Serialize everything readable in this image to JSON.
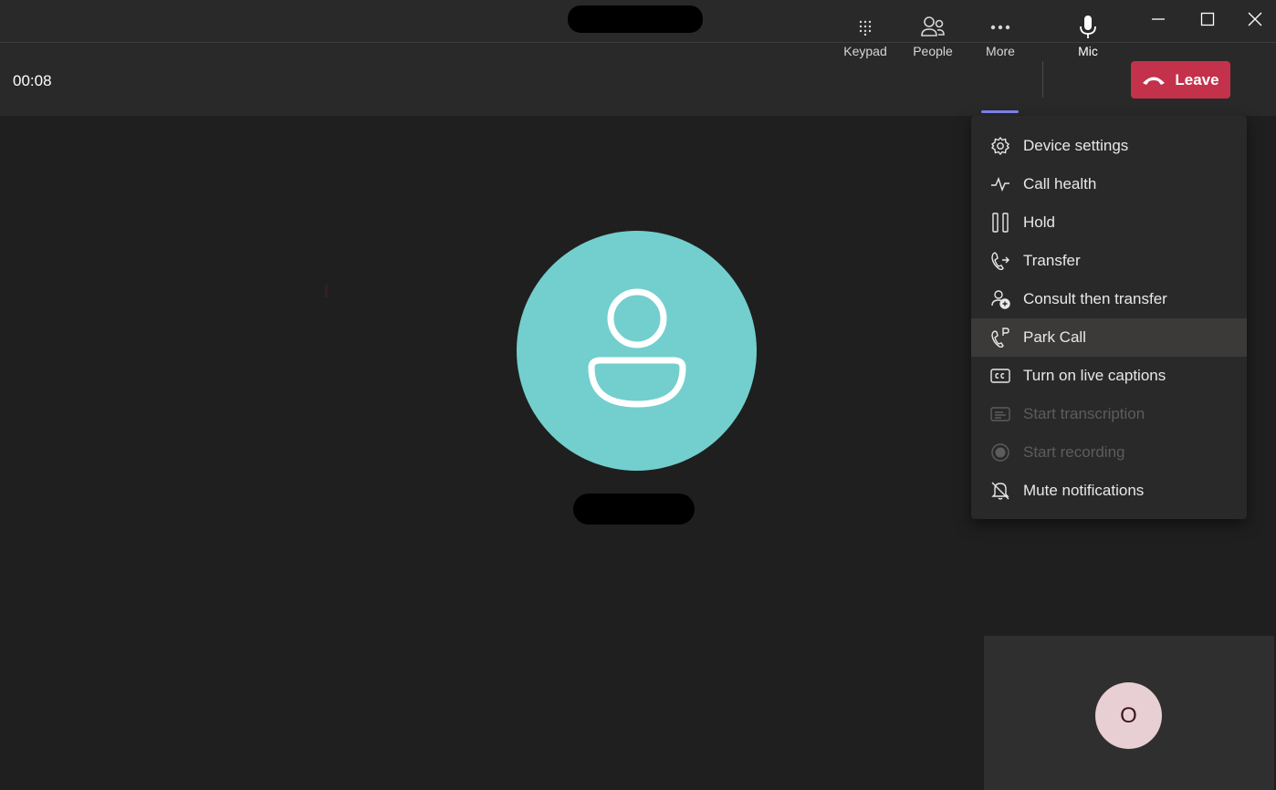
{
  "window": {
    "minimize_icon": "minimize-icon",
    "maximize_icon": "maximize-icon",
    "close_icon": "close-icon"
  },
  "toolbar": {
    "timer": "00:08",
    "keypad_label": "Keypad",
    "people_label": "People",
    "more_label": "More",
    "mic_label": "Mic",
    "leave_label": "Leave"
  },
  "menu": {
    "items": [
      {
        "label": "Device settings",
        "icon": "gear-icon",
        "enabled": true
      },
      {
        "label": "Call health",
        "icon": "pulse-icon",
        "enabled": true
      },
      {
        "label": "Hold",
        "icon": "pause-icon",
        "enabled": true
      },
      {
        "label": "Transfer",
        "icon": "transfer-icon",
        "enabled": true
      },
      {
        "label": "Consult then transfer",
        "icon": "person-add-icon",
        "enabled": true
      },
      {
        "label": "Park Call",
        "icon": "park-call-icon",
        "enabled": true,
        "highlighted": true
      },
      {
        "label": "Turn on live captions",
        "icon": "captions-icon",
        "enabled": true
      },
      {
        "label": "Start transcription",
        "icon": "transcription-icon",
        "enabled": false
      },
      {
        "label": "Start recording",
        "icon": "record-icon",
        "enabled": false
      },
      {
        "label": "Mute notifications",
        "icon": "bell-off-icon",
        "enabled": true
      }
    ]
  },
  "self_tile": {
    "initial": "O"
  },
  "colors": {
    "background": "#1f1f1f",
    "bar": "#292929",
    "leave": "#c4314b",
    "avatar": "#72cfcd",
    "accent": "#7f85f5",
    "self_avatar": "#e8cfd3"
  }
}
